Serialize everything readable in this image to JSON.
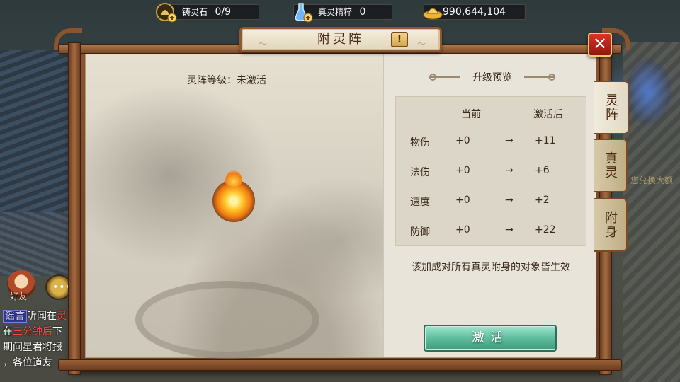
{
  "resources": {
    "casting_stone": {
      "label": "铸灵石",
      "value": "0/9",
      "icon": "gold-stone-plus-icon"
    },
    "true_essence": {
      "label": "真灵精粹",
      "value": "0",
      "icon": "blue-flask-plus-icon"
    },
    "gold": {
      "value": "990,644,104",
      "icon": "gold-ingot-icon"
    }
  },
  "dialog": {
    "title": "附灵阵",
    "help_label": "!",
    "close_label": "✕"
  },
  "left_panel": {
    "level_label": "灵阵等级：未激活"
  },
  "right_panel": {
    "preview_title": "升级预览",
    "headers": {
      "current": "当前",
      "after": "激活后"
    },
    "rows": [
      {
        "name": "物伤",
        "current": "+0",
        "arrow": "→",
        "after": "+11"
      },
      {
        "name": "法伤",
        "current": "+0",
        "arrow": "→",
        "after": "+6"
      },
      {
        "name": "速度",
        "current": "+0",
        "arrow": "→",
        "after": "+2"
      },
      {
        "name": "防御",
        "current": "+0",
        "arrow": "→",
        "after": "+22"
      }
    ],
    "note": "该加成对所有真灵附身的对象皆生效",
    "activate_label": "激活"
  },
  "tabs": [
    {
      "label": "灵阵",
      "active": true
    },
    {
      "label": "真灵",
      "active": false
    },
    {
      "label": "附身",
      "active": false
    }
  ],
  "chat": {
    "friend_label": "好友",
    "bubble_dots": "•••",
    "lines": [
      {
        "tag": "谣言",
        "text": "听闻在",
        "red": "灵"
      },
      {
        "prefix": "在",
        "red": "三分钟后",
        "text": "下"
      },
      {
        "text": "期间星君将报"
      },
      {
        "text": "，各位道友"
      }
    ]
  },
  "scene_text": "您兑换大额",
  "colors": {
    "frame": "#8a5430",
    "paper": "#e9e4d6",
    "activate": "#5fbd9e",
    "close": "#d8342a"
  }
}
